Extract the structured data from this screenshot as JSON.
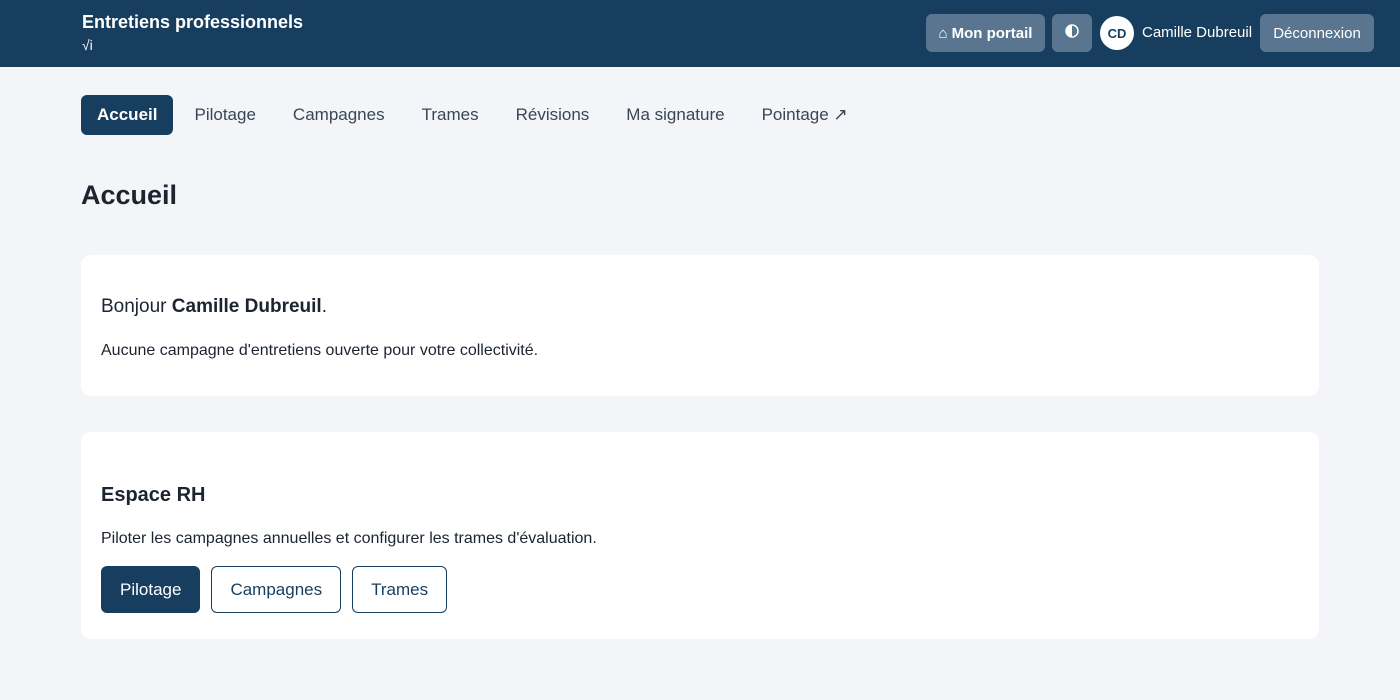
{
  "header": {
    "title": "Entretiens professionnels",
    "subtitle": "√i",
    "portal_icon": "⌂",
    "portal_label": "Mon portail",
    "theme_icon": "contrast-icon",
    "avatar_initials": "CD",
    "user_name": "Camille Dubreuil",
    "logout_label": "Déconnexion"
  },
  "nav": {
    "items": [
      {
        "label": "Accueil",
        "active": true
      },
      {
        "label": "Pilotage"
      },
      {
        "label": "Campagnes"
      },
      {
        "label": "Trames"
      },
      {
        "label": "Révisions"
      },
      {
        "label": "Ma signature"
      },
      {
        "label": "Pointage ↗"
      }
    ]
  },
  "page": {
    "title": "Accueil"
  },
  "welcome": {
    "greeting_prefix": "Bonjour ",
    "greeting_name": "Camille Dubreuil",
    "greeting_suffix": ".",
    "message": "Aucune campagne d'entretiens ouverte pour votre collectivité."
  },
  "rh": {
    "title": "Espace RH",
    "description": "Piloter les campagnes annuelles et configurer les trames d'évaluation.",
    "buttons": [
      "Pilotage",
      "Campagnes",
      "Trames"
    ]
  },
  "colors": {
    "brand": "#173e5f",
    "background": "#f3f5f8"
  }
}
